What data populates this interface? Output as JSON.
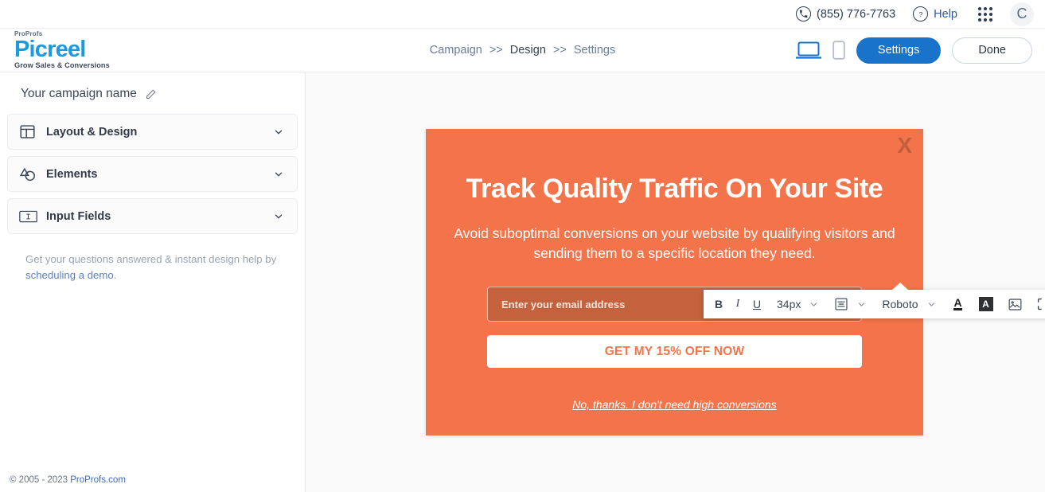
{
  "utility_bar": {
    "phone": "(855) 776-7763",
    "phone_icon": "phone-icon",
    "help_label": "Help",
    "help_icon": "question-circle-icon",
    "apps_icon": "apps-grid-icon",
    "avatar_initial": "C"
  },
  "header": {
    "logo": {
      "sup": "ProProfs",
      "name": "Picreel",
      "tagline": "Grow Sales & Conversions"
    },
    "breadcrumb": [
      {
        "label": "Campaign",
        "active": false
      },
      {
        "label": "Design",
        "active": true
      },
      {
        "label": "Settings",
        "active": false
      }
    ],
    "breadcrumb_separator": ">>",
    "devices": [
      {
        "name": "desktop-view-icon",
        "active": true
      },
      {
        "name": "mobile-view-icon",
        "active": false
      }
    ],
    "settings_label": "Settings",
    "done_label": "Done"
  },
  "sidebar": {
    "campaign_name": "Your campaign name",
    "edit_icon": "pencil-icon",
    "sections": [
      {
        "label": "Layout & Design",
        "icon": "layout-grid-icon"
      },
      {
        "label": "Elements",
        "icon": "shapes-icon"
      },
      {
        "label": "Input Fields",
        "icon": "text-input-icon"
      }
    ],
    "help_note_text": "Get your questions answered & instant design help by ",
    "help_note_link": "scheduling a demo",
    "help_note_end": ".",
    "footer_copy": "© 2005 - 2023 ",
    "footer_link": "ProProfs.com"
  },
  "editor_toolbar": {
    "bold": "B",
    "italic": "I",
    "underline": "U",
    "font_size": "34px",
    "align_icon": "text-align-icon",
    "font_family": "Roboto",
    "font_color_icon": "font-color-icon",
    "highlight_icon": "text-highlight-icon",
    "image_icon": "image-icon",
    "resize_icon": "resize-corners-icon",
    "reset_icon": "reset-style-icon",
    "delete_icon": "trash-icon",
    "chevron_icon": "chevron-down-icon"
  },
  "popup": {
    "close_label": "X",
    "heading": "Track Quality Traffic On Your Site",
    "body": "Avoid suboptimal conversions on your website by qualifying visitors and sending them to a specific location they need.",
    "email_placeholder": "Enter your email address",
    "cta_label": "GET MY 15% OFF NOW",
    "decline_label": "No, thanks. I don't need high conversions",
    "background_color": "#F3744A",
    "cta_text_color": "#F3744A",
    "input_color": "#C4623D"
  }
}
